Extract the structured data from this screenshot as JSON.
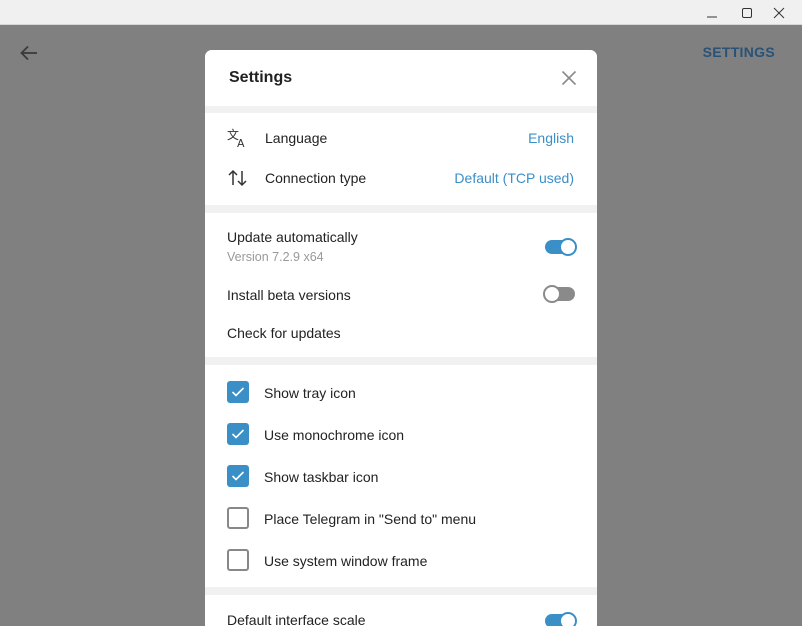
{
  "background": {
    "header_title": "SETTINGS"
  },
  "dialog": {
    "title": "Settings",
    "general": {
      "language_label": "Language",
      "language_value": "English",
      "connection_label": "Connection type",
      "connection_value": "Default (TCP used)"
    },
    "updates": {
      "auto_update_label": "Update automatically",
      "auto_update_on": true,
      "version": "Version 7.2.9 x64",
      "beta_label": "Install beta versions",
      "beta_on": false,
      "check_label": "Check for updates"
    },
    "tray": {
      "items": [
        {
          "label": "Show tray icon",
          "checked": true
        },
        {
          "label": "Use monochrome icon",
          "checked": true
        },
        {
          "label": "Show taskbar icon",
          "checked": true
        },
        {
          "label": "Place Telegram in \"Send to\" menu",
          "checked": false
        },
        {
          "label": "Use system window frame",
          "checked": false
        }
      ]
    },
    "scale": {
      "label": "Default interface scale",
      "on": true
    }
  },
  "colors": {
    "accent": "#3a8fc7",
    "toggle_off": "#8a8a8a"
  }
}
